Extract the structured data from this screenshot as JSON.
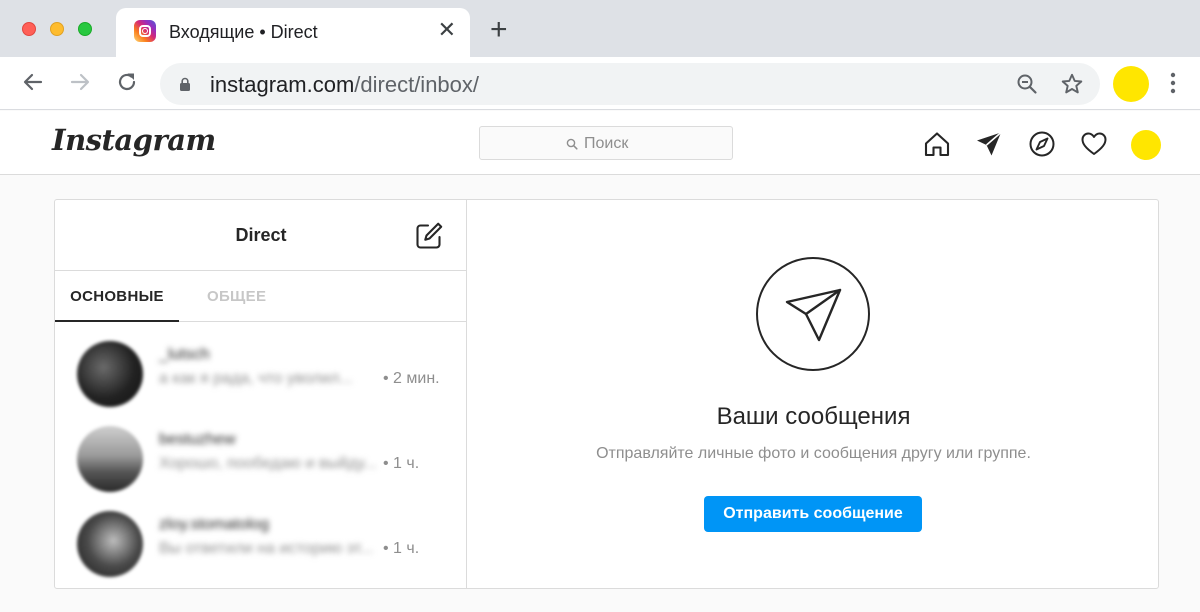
{
  "browser": {
    "tab_title": "Входящие • Direct",
    "tab_close": "✕",
    "new_tab": "+",
    "url_host": "instagram.com",
    "url_path": "/direct/inbox/",
    "profile_color": "#ffe600"
  },
  "header": {
    "logo": "Instagram",
    "search_placeholder": "Поиск",
    "icons": [
      "home-icon",
      "direct-icon",
      "explore-icon",
      "activity-heart-icon"
    ]
  },
  "direct": {
    "title": "Direct",
    "tabs": [
      {
        "label": "ОСНОВНЫЕ",
        "active": true
      },
      {
        "label": "ОБЩЕЕ",
        "active": false
      }
    ],
    "threads": [
      {
        "username": "_lutsch",
        "preview": "а как я рада, что уволил...",
        "time": "• 2 мин."
      },
      {
        "username": "bestuzhew",
        "preview": "Хорошо, пообедаю и выйду...",
        "time": "• 1 ч."
      },
      {
        "username": "zloy.stomatolog",
        "preview": "Вы ответили на историю эт...",
        "time": "• 1 ч."
      }
    ]
  },
  "empty_state": {
    "title": "Ваши сообщения",
    "subtitle": "Отправляйте личные фото и сообщения другу или группе.",
    "button": "Отправить сообщение"
  },
  "colors": {
    "accent": "#0095f6",
    "border": "#dbdbdb",
    "muted_text": "#8e8e8e"
  }
}
